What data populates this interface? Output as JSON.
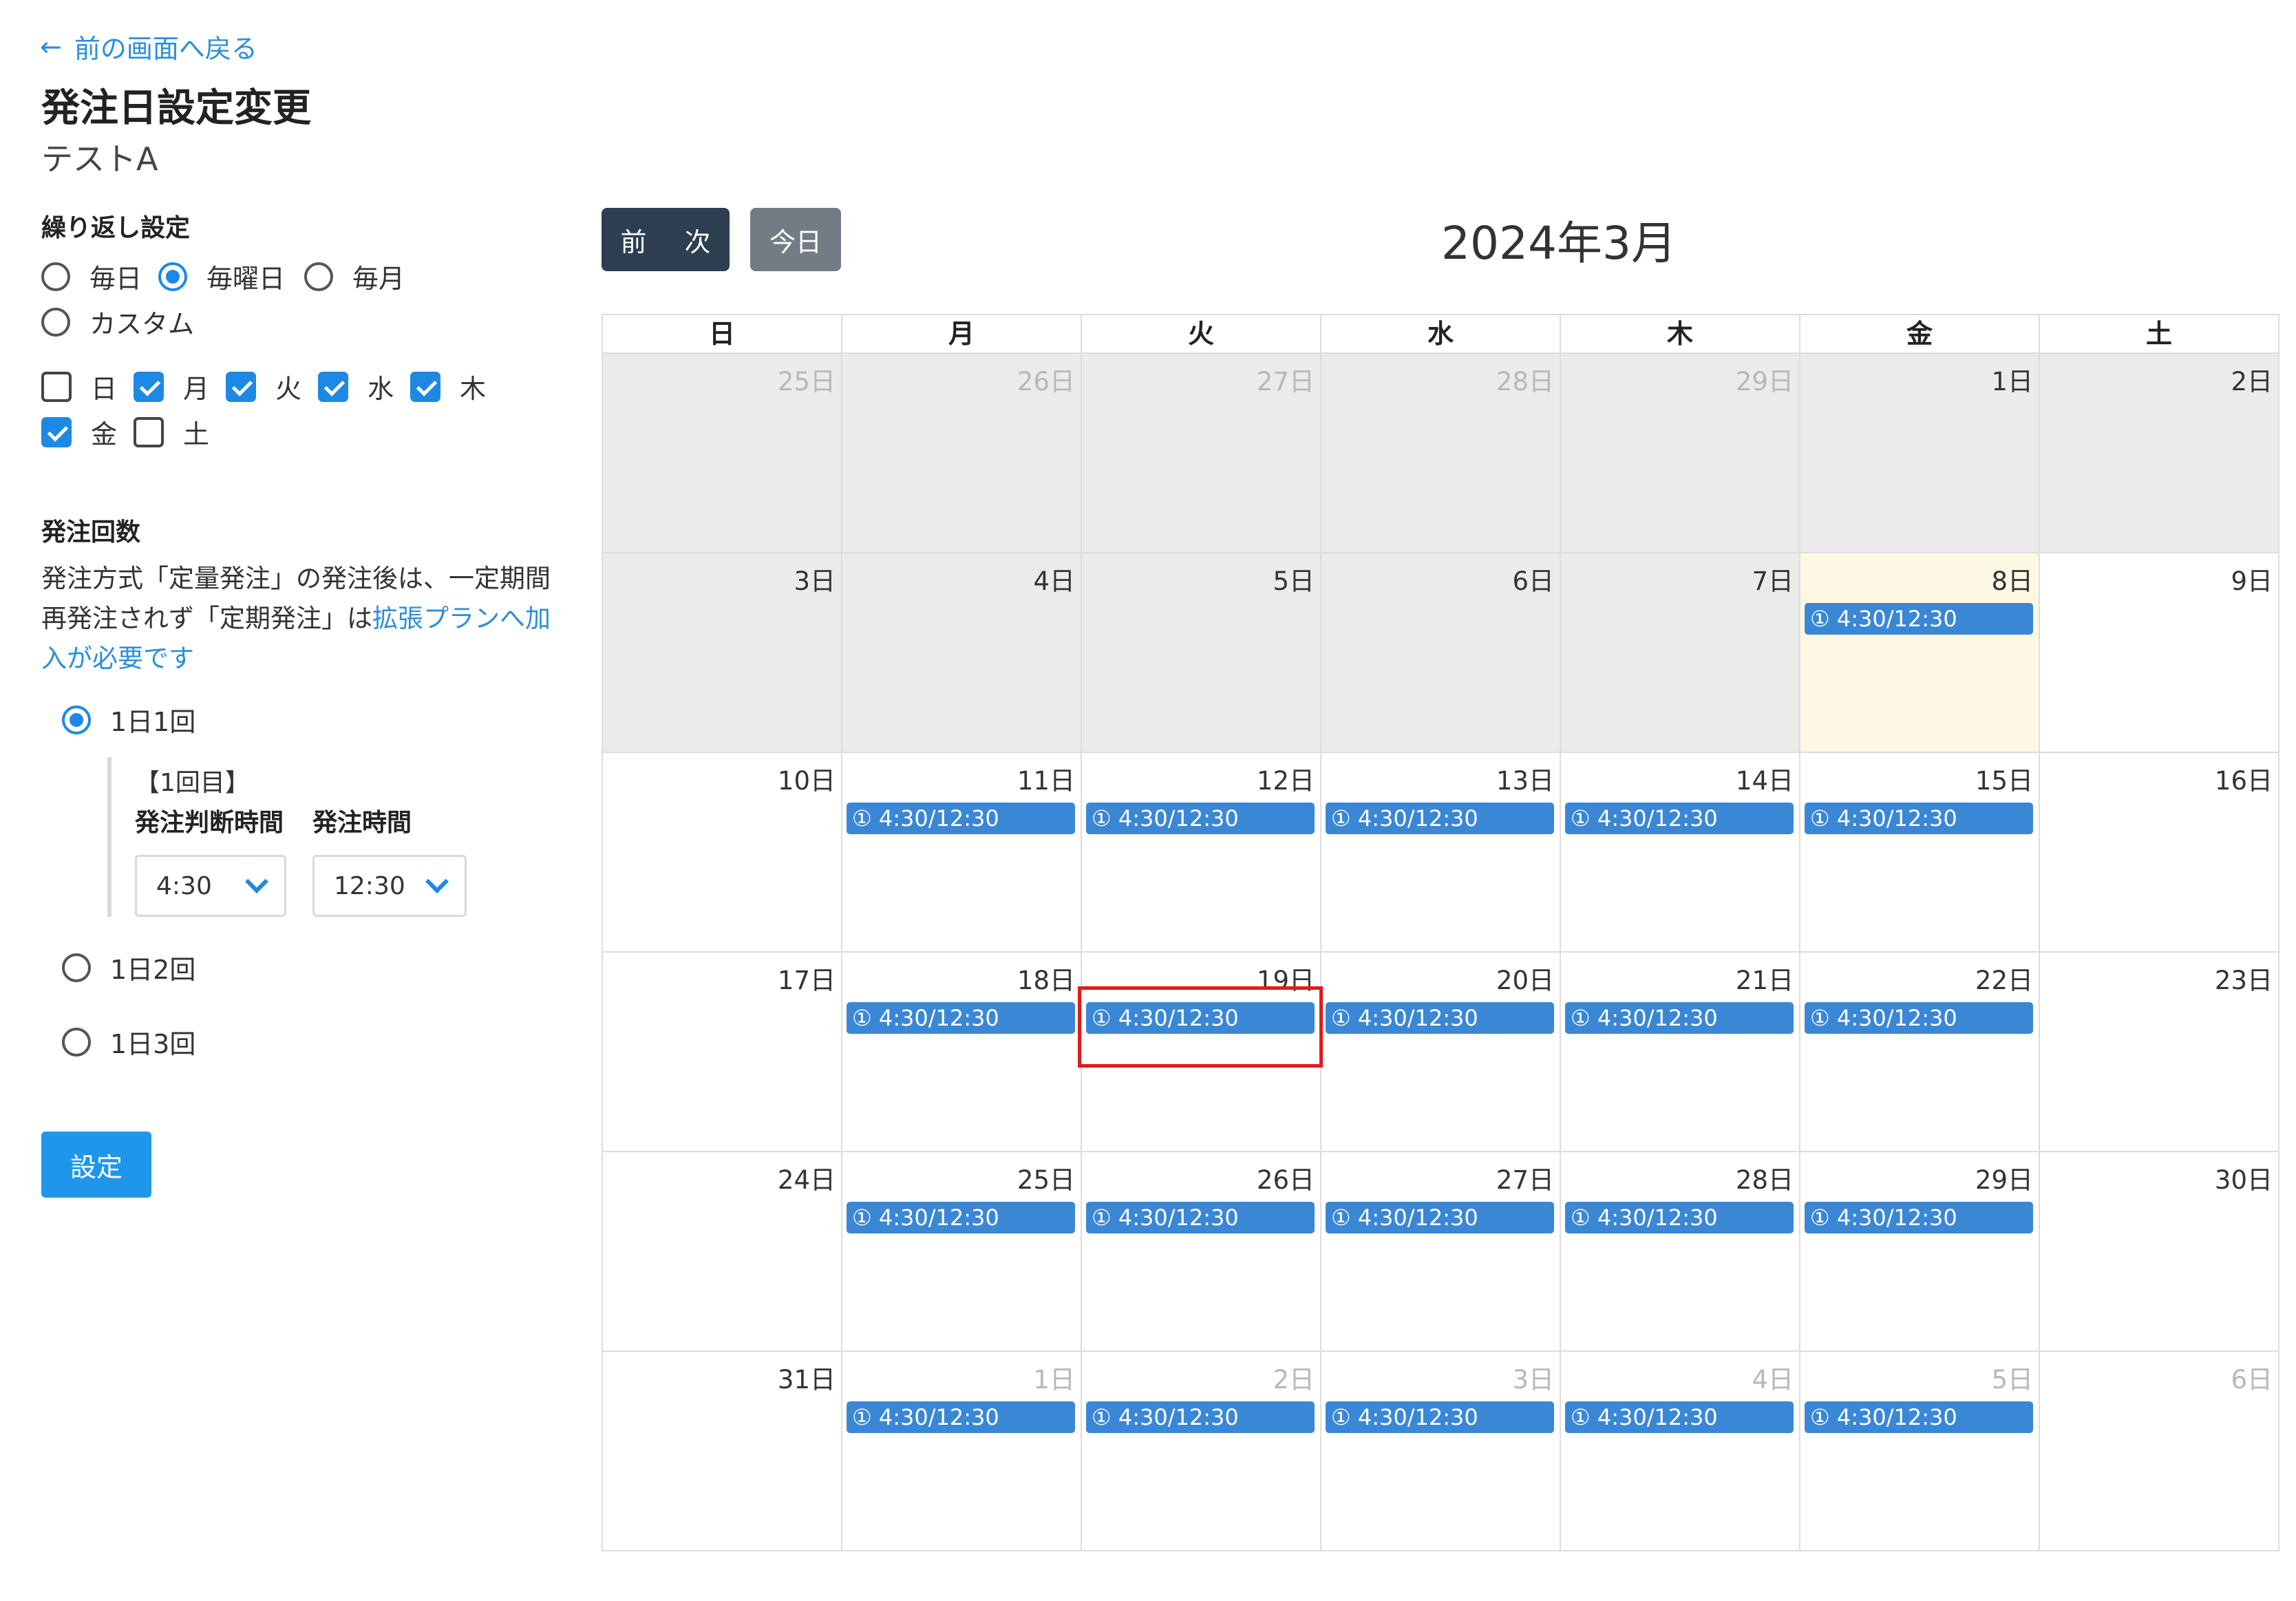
{
  "back_link": "前の画面へ戻る",
  "page_title": "発注日設定変更",
  "subtitle": "テストA",
  "repeat": {
    "title": "繰り返し設定",
    "options": [
      {
        "label": "毎日",
        "checked": false
      },
      {
        "label": "毎曜日",
        "checked": true
      },
      {
        "label": "毎月",
        "checked": false
      },
      {
        "label": "カスタム",
        "checked": false
      }
    ],
    "weekdays": [
      {
        "label": "日",
        "checked": false
      },
      {
        "label": "月",
        "checked": true
      },
      {
        "label": "火",
        "checked": true
      },
      {
        "label": "水",
        "checked": true
      },
      {
        "label": "木",
        "checked": true
      },
      {
        "label": "金",
        "checked": true
      },
      {
        "label": "土",
        "checked": false
      }
    ]
  },
  "count": {
    "title": "発注回数",
    "desc_pre": "発注方式「定量発注」の発注後は、一定期間再発注されず「定期発注」は",
    "desc_link": "拡張プランへ加入が必要です",
    "options": [
      {
        "label": "1日1回",
        "checked": true
      },
      {
        "label": "1日2回",
        "checked": false
      },
      {
        "label": "1日3回",
        "checked": false
      }
    ],
    "block_label": "【1回目】",
    "judge_label": "発注判断時間",
    "order_label": "発注時間",
    "judge_value": "4:30",
    "order_value": "12:30"
  },
  "set_button": "設定",
  "calendar": {
    "prev": "前",
    "next": "次",
    "today": "今日",
    "title": "2024年3月",
    "headers": [
      "日",
      "月",
      "火",
      "水",
      "木",
      "金",
      "土"
    ],
    "weeks": [
      [
        {
          "d": "25日",
          "o": true,
          "p": true
        },
        {
          "d": "26日",
          "o": true,
          "p": true
        },
        {
          "d": "27日",
          "o": true,
          "p": true
        },
        {
          "d": "28日",
          "o": true,
          "p": true
        },
        {
          "d": "29日",
          "o": true,
          "p": true
        },
        {
          "d": "1日",
          "p": true
        },
        {
          "d": "2日",
          "p": true
        }
      ],
      [
        {
          "d": "3日",
          "p": true
        },
        {
          "d": "4日",
          "p": true
        },
        {
          "d": "5日",
          "p": true
        },
        {
          "d": "6日",
          "p": true
        },
        {
          "d": "7日",
          "p": true
        },
        {
          "d": "8日",
          "t": true,
          "e": "① 4:30/12:30"
        },
        {
          "d": "9日"
        }
      ],
      [
        {
          "d": "10日"
        },
        {
          "d": "11日",
          "e": "① 4:30/12:30"
        },
        {
          "d": "12日",
          "e": "① 4:30/12:30"
        },
        {
          "d": "13日",
          "e": "① 4:30/12:30"
        },
        {
          "d": "14日",
          "e": "① 4:30/12:30"
        },
        {
          "d": "15日",
          "e": "① 4:30/12:30"
        },
        {
          "d": "16日"
        }
      ],
      [
        {
          "d": "17日"
        },
        {
          "d": "18日",
          "e": "① 4:30/12:30"
        },
        {
          "d": "19日",
          "e": "① 4:30/12:30"
        },
        {
          "d": "20日",
          "e": "① 4:30/12:30"
        },
        {
          "d": "21日",
          "e": "① 4:30/12:30"
        },
        {
          "d": "22日",
          "e": "① 4:30/12:30"
        },
        {
          "d": "23日"
        }
      ],
      [
        {
          "d": "24日"
        },
        {
          "d": "25日",
          "e": "① 4:30/12:30"
        },
        {
          "d": "26日",
          "e": "① 4:30/12:30"
        },
        {
          "d": "27日",
          "e": "① 4:30/12:30"
        },
        {
          "d": "28日",
          "e": "① 4:30/12:30"
        },
        {
          "d": "29日",
          "e": "① 4:30/12:30"
        },
        {
          "d": "30日"
        }
      ],
      [
        {
          "d": "31日"
        },
        {
          "d": "1日",
          "o": true,
          "e": "① 4:30/12:30"
        },
        {
          "d": "2日",
          "o": true,
          "e": "① 4:30/12:30"
        },
        {
          "d": "3日",
          "o": true,
          "e": "① 4:30/12:30"
        },
        {
          "d": "4日",
          "o": true,
          "e": "① 4:30/12:30"
        },
        {
          "d": "5日",
          "o": true,
          "e": "① 4:30/12:30"
        },
        {
          "d": "6日",
          "o": true
        }
      ]
    ]
  }
}
